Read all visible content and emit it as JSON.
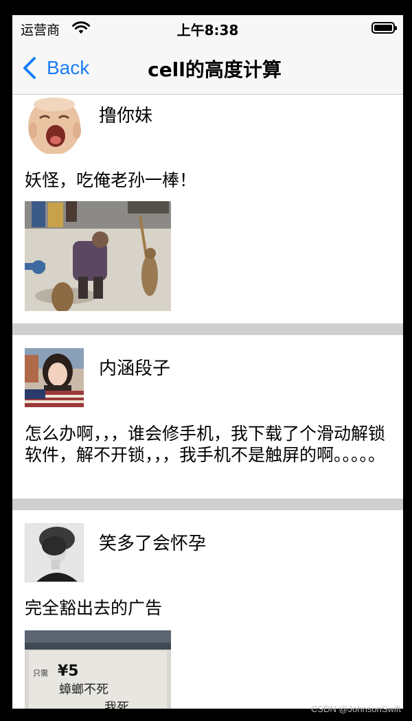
{
  "status_bar": {
    "carrier": "运营商",
    "time": "上午8:38"
  },
  "nav": {
    "back_label": "Back",
    "title": "cell的高度计算"
  },
  "posts": [
    {
      "nickname": "撸你妹",
      "text": "妖怪，吃俺老孙一棒！"
    },
    {
      "nickname": "内涵段子",
      "text": "怎么办啊，，，谁会修手机，我下载了个滑动解锁软件，解不开锁，，，我手机不是触屏的啊。。。。。"
    },
    {
      "nickname": "笑多了会怀孕",
      "text": "完全豁出去的广告",
      "photo_text": {
        "price_prefix": "只需",
        "price": "¥5",
        "line1": "蟑螂不死",
        "line2": "我死"
      }
    }
  ],
  "watermark": "CSDN @JohnsonSwift"
}
